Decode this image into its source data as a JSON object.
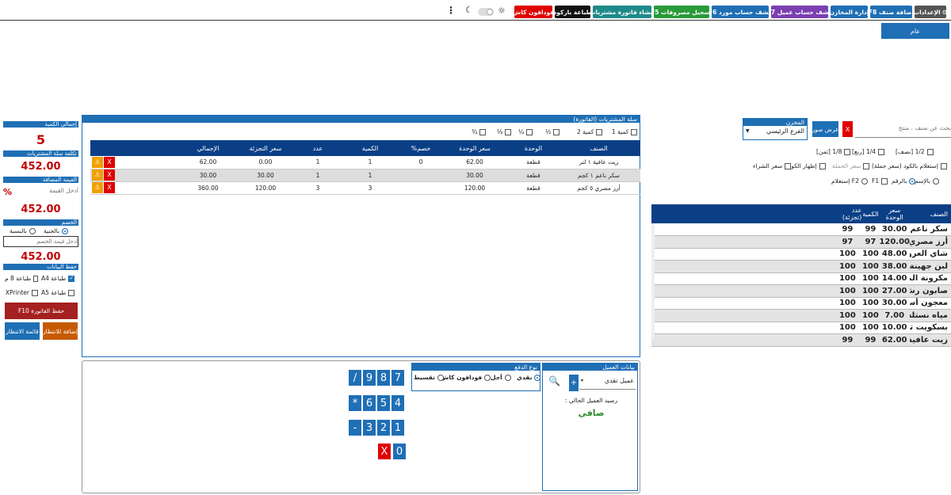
{
  "toolbar": {
    "settings": "الإعدادات",
    "add_item": "إضافة صنف F8",
    "stores": "إدارة المخازن",
    "customer_statement": "كشف حساب عميل F7",
    "supplier_statement": "كشف حساب مورد F6",
    "expenses": "تسجيل مصروفات F5",
    "purchase_invoice": "انشاء فاتورة مشتريات",
    "print_barcode": "طباعة باركود",
    "vodafone": "فودافون كاش"
  },
  "tab": {
    "label": "عام"
  },
  "store": {
    "label": "المخزن",
    "value": "الفرع الرئيسي"
  },
  "search": {
    "placeholder": "بحث عن صنف ، منتج",
    "clear": "X",
    "show_images": "عرض صور"
  },
  "options": {
    "half": "1/2 [نصف]",
    "quarter": "1/4 [ربع]",
    "eighth": "1/8 [ثمن]",
    "wholesale_barcode": "إستعلام بالكود (سعر جملة)",
    "wholesale_price": "سعر الجملة",
    "show_code": "إظهار الكود",
    "purchase_price": "سعر الشراء",
    "by_name": "بالإسم",
    "by_number": "بالرقم",
    "f1": "F1",
    "f2_query": "F2 إستعلام"
  },
  "products": {
    "headers": [
      "الصنف",
      "سعر الوحدة",
      "الكمية",
      "عدد (تجزئة)"
    ],
    "rows": [
      {
        "name": "سكر ناعم ١ كجم",
        "price": "30.00",
        "qty": "99",
        "count": "99"
      },
      {
        "name": "أرز مصري ٥ كجم",
        "price": "120.00",
        "qty": "97",
        "count": "97"
      },
      {
        "name": "شاي العروسة",
        "price": "48.00",
        "qty": "100",
        "count": "100"
      },
      {
        "name": "لبن جهينة ١ لتر",
        "price": "38.00",
        "qty": "100",
        "count": "100"
      },
      {
        "name": "مكرونة الملكة",
        "price": "14.00",
        "qty": "100",
        "count": "100"
      },
      {
        "name": "صابون رش ٠",
        "price": "27.00",
        "qty": "100",
        "count": "100"
      },
      {
        "name": "معجون أسنان",
        "price": "30.00",
        "qty": "100",
        "count": "100"
      },
      {
        "name": "مياه نستله ١.٥",
        "price": "7.00",
        "qty": "100",
        "count": "100"
      },
      {
        "name": "بسكويت تودو",
        "price": "10.00",
        "qty": "100",
        "count": "100"
      },
      {
        "name": "زيت عافية ١ لتر",
        "price": "62.00",
        "qty": "99",
        "count": "99"
      }
    ]
  },
  "cart": {
    "title": "سلة المشتريات (الفاتورة)",
    "opts": [
      "كمية 1",
      "كمية 2",
      "½",
      "¼",
      "⅛",
      "¾"
    ],
    "headers": [
      "الصنف",
      "الوحدة",
      "سعر الوحدة",
      "خصم%",
      "الكمية",
      "عدد",
      "سعر التجزئة",
      "الإجمالي"
    ],
    "rows": [
      {
        "name": "زيت عافية ١ لتر",
        "unit": "قطعة",
        "price": "62.00",
        "disc": "0",
        "qty": "1",
        "count": "1",
        "retail": "0.00",
        "total": "62.00"
      },
      {
        "name": "سكر ناعم ١ كجم",
        "unit": "قطعة",
        "price": "30.00",
        "disc": "",
        "qty": "1",
        "count": "1",
        "retail": "30.00",
        "total": "30.00"
      },
      {
        "name": "أرز مصري ٥ كجم",
        "unit": "قطعة",
        "price": "120.00",
        "disc": "",
        "qty": "3",
        "count": "3",
        "retail": "120.00",
        "total": "360.00"
      }
    ],
    "del": "X"
  },
  "summary": {
    "total_qty_label": "إجمالي الكمية",
    "total_qty": "5",
    "cart_cost_label": "تكلفة سلة المشتريات",
    "cart_cost": "452.00",
    "vat_label": "القيمة المضافة",
    "vat_placeholder": "أدخل القيمة",
    "percent": "%",
    "vat_total": "452.00",
    "discount_label": "الخصم",
    "by_amount": "بالجنية",
    "by_percent": "بالنسبة",
    "discount_placeholder": "ادخل قيمة الخصم",
    "after_discount": "452.00",
    "save_label": "حفظ البيانات",
    "a4": "طباعة A4",
    "print8": "طباعة 8 م",
    "a5": "طباعة A5",
    "xprinter": "XPrinter",
    "save_invoice": "حفظ الفاتورة F10",
    "wait_list": "قائمة الانتظار",
    "add_wait": "إضافة للانتظار"
  },
  "customer": {
    "title": "بيانات العميل",
    "name": "عميل نقدي",
    "add": "+",
    "balance_label": "رصيد العميل الحالي :",
    "balance": "صافي"
  },
  "payment": {
    "title": "نوع الدفع",
    "cash": "نقدي",
    "credit": "آجل",
    "vodafone": "فودافون كاش",
    "installment": "تقسيط"
  },
  "keypad": {
    "keys": [
      "7",
      "8",
      "9",
      "/",
      "4",
      "5",
      "6",
      "*",
      "1",
      "2",
      "3",
      "-",
      "0",
      "X"
    ]
  },
  "colors": {
    "primary": "#1f6fb5",
    "header": "#0a3f86",
    "danger": "#e00000",
    "total": "#c40000",
    "ok": "#2e8b2e"
  }
}
